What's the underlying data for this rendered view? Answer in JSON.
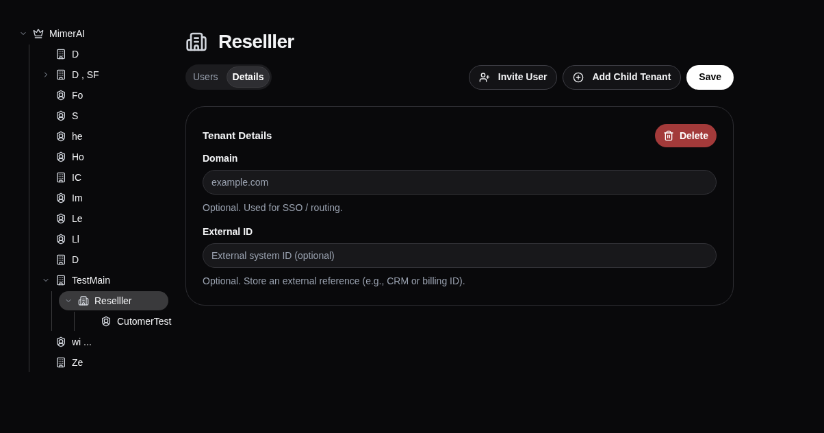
{
  "sidebar": {
    "tree": [
      {
        "label": "MimerAI",
        "kind": "crown",
        "expanded": true,
        "selected": false,
        "children": [
          {
            "label": "D",
            "kind": "building",
            "selected": false
          },
          {
            "label": "D , SF",
            "kind": "building",
            "expanded": false,
            "selected": false
          },
          {
            "label": "Fo",
            "kind": "shield",
            "selected": false
          },
          {
            "label": "S",
            "kind": "shield",
            "selected": false
          },
          {
            "label": "he",
            "kind": "shield",
            "selected": false
          },
          {
            "label": "Ho",
            "kind": "shield",
            "selected": false
          },
          {
            "label": "IC",
            "kind": "building",
            "selected": false
          },
          {
            "label": "Im",
            "kind": "shield",
            "selected": false
          },
          {
            "label": "Le",
            "kind": "shield",
            "selected": false
          },
          {
            "label": "Ll",
            "kind": "shield",
            "selected": false
          },
          {
            "label": "D",
            "kind": "building",
            "selected": false
          },
          {
            "label": "TestMain",
            "kind": "building",
            "expanded": true,
            "selected": false,
            "children": [
              {
                "label": "Reselller",
                "kind": "reseller",
                "expanded": true,
                "selected": true,
                "children": [
                  {
                    "label": "CutomerTest",
                    "kind": "shield",
                    "selected": false
                  }
                ]
              }
            ]
          },
          {
            "label": "wi ...",
            "kind": "shield",
            "selected": false
          },
          {
            "label": "Ze",
            "kind": "building",
            "selected": false
          }
        ]
      }
    ]
  },
  "header": {
    "title": "Reselller",
    "kind": "reseller"
  },
  "tabs": [
    {
      "label": "Users",
      "selected": false
    },
    {
      "label": "Details",
      "selected": true
    }
  ],
  "actions": [
    {
      "label": "Invite User",
      "kind": "invite"
    },
    {
      "label": "Add Child Tenant",
      "kind": "add"
    },
    {
      "label": "Save",
      "kind": "primary"
    }
  ],
  "card": {
    "title": "Tenant Details",
    "delete_label": "Delete",
    "fields": [
      {
        "label": "Domain",
        "placeholder": "example.com",
        "help": "Optional. Used for SSO / routing."
      },
      {
        "label": "External ID",
        "placeholder": "External system ID (optional)",
        "help": "Optional. Store an external reference (e.g., CRM or billing ID)."
      }
    ]
  }
}
